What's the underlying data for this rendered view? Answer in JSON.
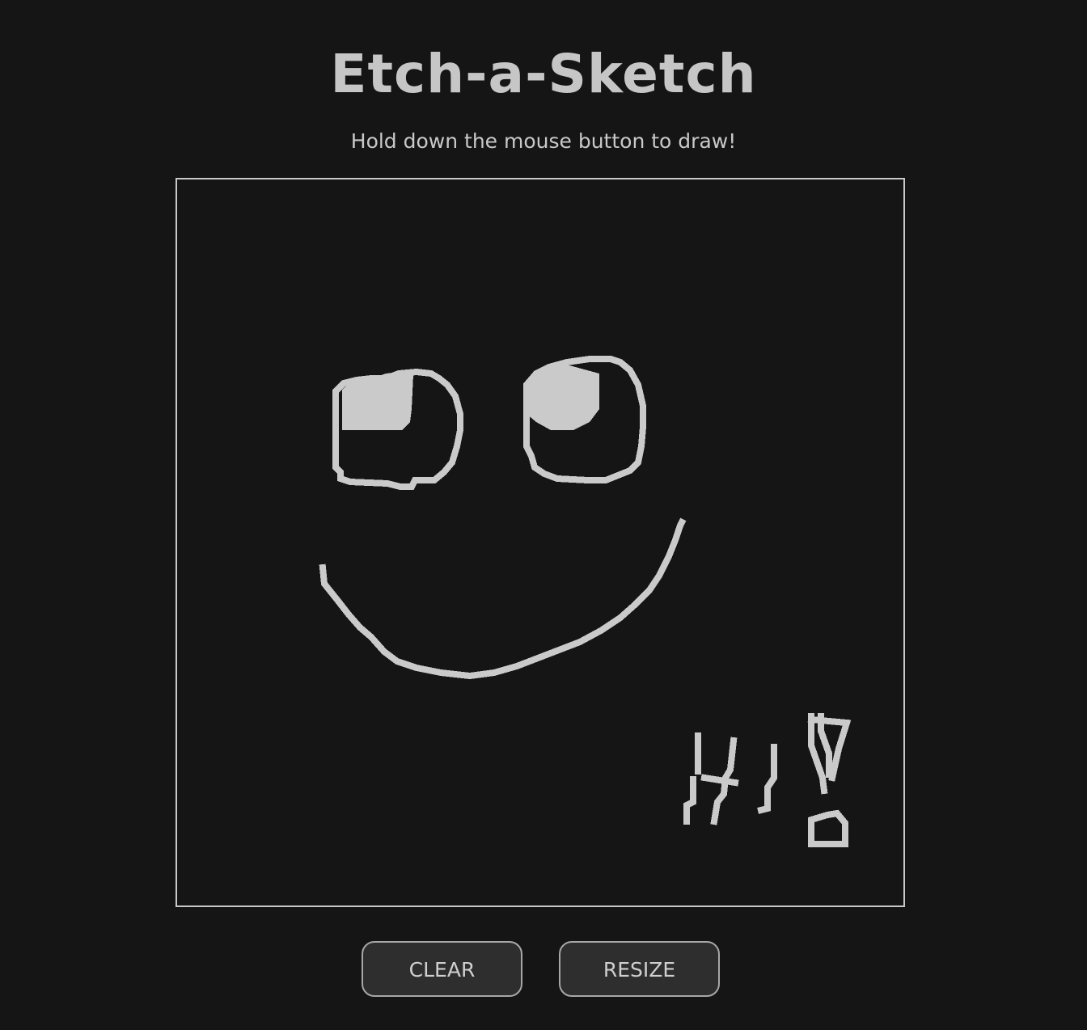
{
  "app": {
    "title": "Etch-a-Sketch",
    "instructions": "Hold down the mouse button to draw!"
  },
  "colors": {
    "background": "#151515",
    "ink": "#c9c9c9",
    "button_bg": "#2e2e2e",
    "button_border": "#a7a7a7"
  },
  "controls": {
    "clear_label": "CLEAR",
    "resize_label": "RESIZE"
  }
}
